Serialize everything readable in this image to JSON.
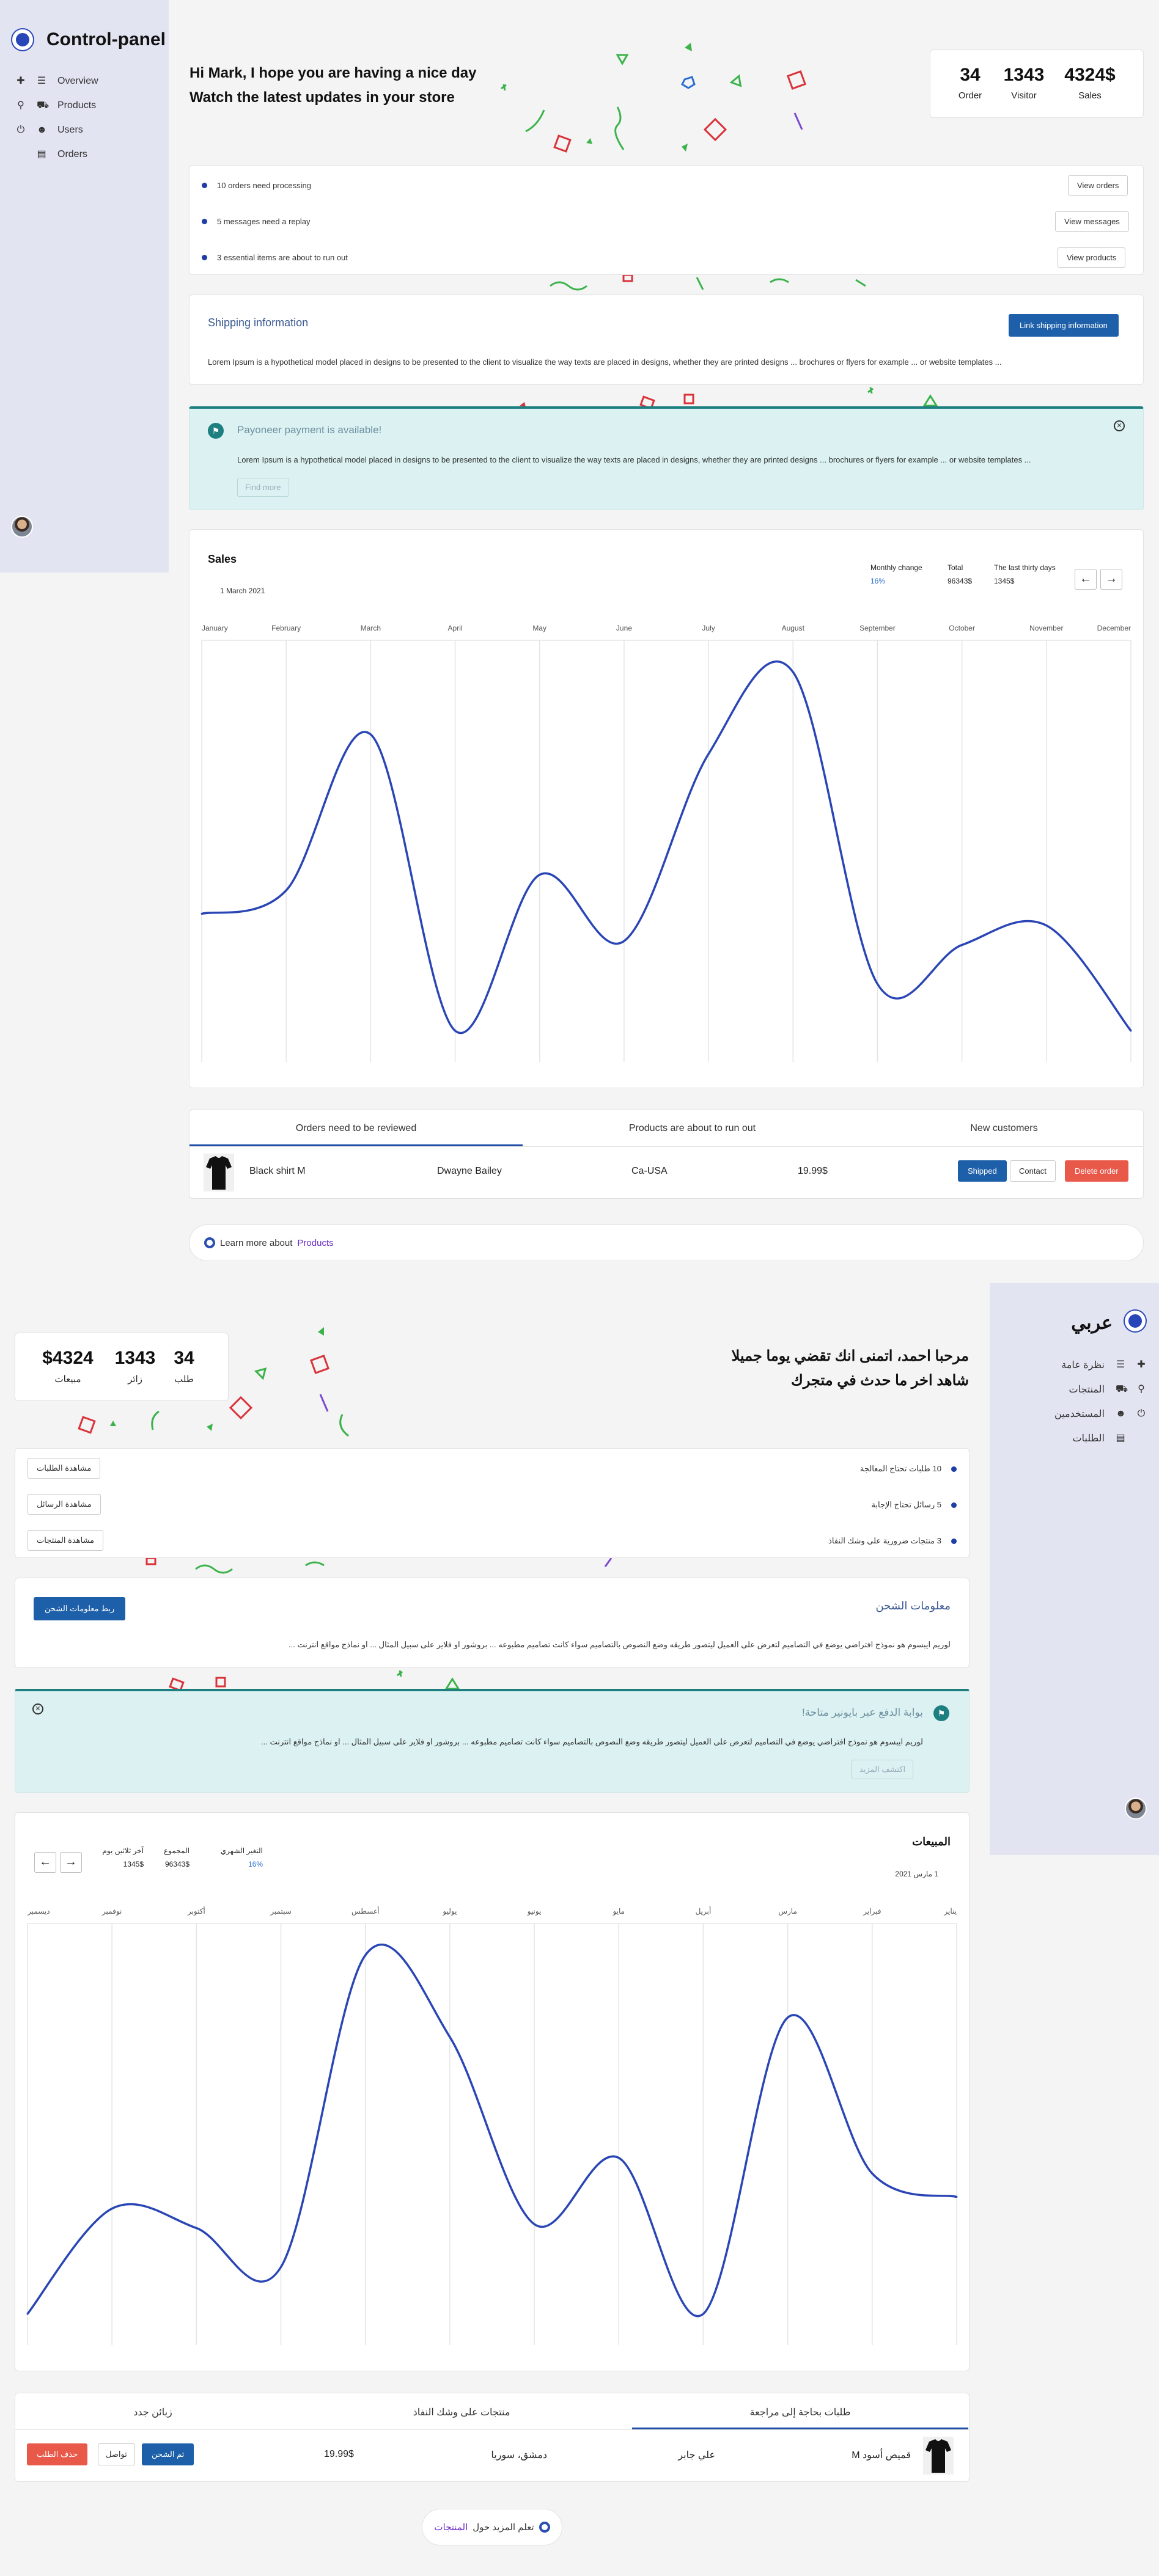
{
  "en": {
    "brand": "Control-panel",
    "nav": [
      "Overview",
      "Products",
      "Users",
      "Orders"
    ],
    "greeting_line1": "Hi Mark, I hope you are having a nice day",
    "greeting_line2": "Watch the latest updates in your store",
    "stats": [
      {
        "value": "34",
        "label": "Order"
      },
      {
        "value": "1343",
        "label": "Visitor"
      },
      {
        "value": "4324$",
        "label": "Sales"
      }
    ],
    "todos": [
      {
        "text": "10 orders need processing",
        "button": "View orders"
      },
      {
        "text": "5 messages need a replay",
        "button": "View messages"
      },
      {
        "text": "3 essential items are about to run out",
        "button": "View products"
      }
    ],
    "shipping": {
      "title": "Shipping information",
      "button": "Link shipping information",
      "text": "Lorem Ipsum is a hypothetical model placed in designs to be presented to the client to visualize the way texts are placed in designs, whether they are printed designs ... brochures or flyers for example ... or website templates ..."
    },
    "payoneer": {
      "title": "Payoneer payment is available!",
      "text": "Lorem Ipsum is a hypothetical model placed in designs to be presented to the client to visualize the way texts are placed in designs, whether they are printed designs ... brochures or flyers for example ... or website templates ...",
      "button": "Find more"
    },
    "sales": {
      "title": "Sales",
      "date": "1 March 2021",
      "kpis": [
        {
          "label": "Monthly change",
          "value": "16%",
          "color": "#2b6fc9"
        },
        {
          "label": "Total",
          "value": "96343$",
          "color": "#222"
        },
        {
          "label": "The last thirty days",
          "value": "1345$",
          "color": "#222"
        }
      ]
    },
    "tabs": [
      "Orders need to be reviewed",
      "Products are about to run out",
      "New customers"
    ],
    "order": {
      "product": "Black shirt M",
      "customer": "Dwayne Bailey",
      "location": "Ca-USA",
      "price": "19.99$",
      "shipped": "Shipped",
      "contact": "Contact",
      "delete": "Delete order"
    },
    "learn_prefix": "Learn more about",
    "learn_link": "Products"
  },
  "ar": {
    "brand": "عربي",
    "nav": [
      "نظرة عامة",
      "المنتجات",
      "المستخدمين",
      "الطلبات"
    ],
    "greeting_line1": "مرحبا احمد، اتمنى انك تقضي يوما جميلا",
    "greeting_line2": "شاهد اخر ما حدث في متجرك",
    "stats": [
      {
        "value": "34",
        "label": "طلب"
      },
      {
        "value": "1343",
        "label": "زائر"
      },
      {
        "value": "$4324",
        "label": "مبيعات"
      }
    ],
    "todos": [
      {
        "text": "10 طلبات تحتاج المعالجة",
        "button": "مشاهدة الطلبات"
      },
      {
        "text": "5 رسائل تحتاج الإجابة",
        "button": "مشاهدة الرسائل"
      },
      {
        "text": "3 منتجات ضرورية على وشك النفاذ",
        "button": "مشاهدة المنتجات"
      }
    ],
    "shipping": {
      "title": "معلومات الشحن",
      "button": "ربط معلومات الشحن",
      "text": "لوريم ايبسوم هو نموذج افتراضي يوضع في التصاميم لتعرض على العميل ليتصور طريقه وضع النصوص بالتصاميم سواء كانت تصاميم مطبوعه ... بروشور او فلاير على سبيل المثال ... او نماذج مواقع انترنت ..."
    },
    "payoneer": {
      "title": "بوابة الدفع عبر بايونير متاحة!",
      "text": "لوريم ايبسوم هو نموذج افتراضي يوضع في التصاميم لتعرض على العميل ليتصور طريقه وضع النصوص بالتصاميم سواء كانت تصاميم مطبوعه ... بروشور او فلاير على سبيل المثال ... او نماذج مواقع انترنت ...",
      "button": "اكتشف المزيد"
    },
    "sales": {
      "title": "المبيعات",
      "date": "1 مارس 2021",
      "kpis": [
        {
          "label": "التغير الشهري",
          "value": "16%",
          "color": "#2b6fc9"
        },
        {
          "label": "المجموع",
          "value": "96343$",
          "color": "#222"
        },
        {
          "label": "آخر ثلاثين يوم",
          "value": "1345$",
          "color": "#222"
        }
      ]
    },
    "tabs": [
      "طلبات بحاجة إلى مراجعة",
      "منتجات على وشك النفاذ",
      "زبائن جدد"
    ],
    "order": {
      "product": "قميص أسود M",
      "customer": "علي جابر",
      "location": "دمشق، سوريا",
      "price": "19.99$",
      "shipped": "تم الشحن",
      "contact": "تواصل",
      "delete": "حذف الطلب"
    },
    "learn_prefix": "تعلم المزيد حول",
    "learn_link": "المنتجات"
  },
  "chart_data": [
    {
      "type": "line",
      "title": "Sales",
      "categories": [
        "January",
        "February",
        "March",
        "April",
        "May",
        "June",
        "July",
        "August",
        "September",
        "October",
        "November",
        "December"
      ],
      "values": [
        38,
        44,
        84,
        8,
        48,
        31,
        79,
        100,
        20,
        30,
        35,
        8
      ],
      "ylim": [
        0,
        105
      ],
      "color": "#2a46b5",
      "grid": "vertical"
    },
    {
      "type": "line",
      "title": "المبيعات",
      "categories": [
        "يناير",
        "فبراير",
        "مارس",
        "أبريل",
        "مايو",
        "يونيو",
        "يوليو",
        "أغسطس",
        "سبتمبر",
        "أكتوبر",
        "نوفمبر",
        "ديسمبر"
      ],
      "values": [
        38,
        44,
        84,
        8,
        48,
        31,
        79,
        100,
        20,
        30,
        35,
        8
      ],
      "ylim": [
        0,
        105
      ],
      "color": "#2a46b5",
      "grid": "vertical",
      "direction": "rtl"
    }
  ]
}
